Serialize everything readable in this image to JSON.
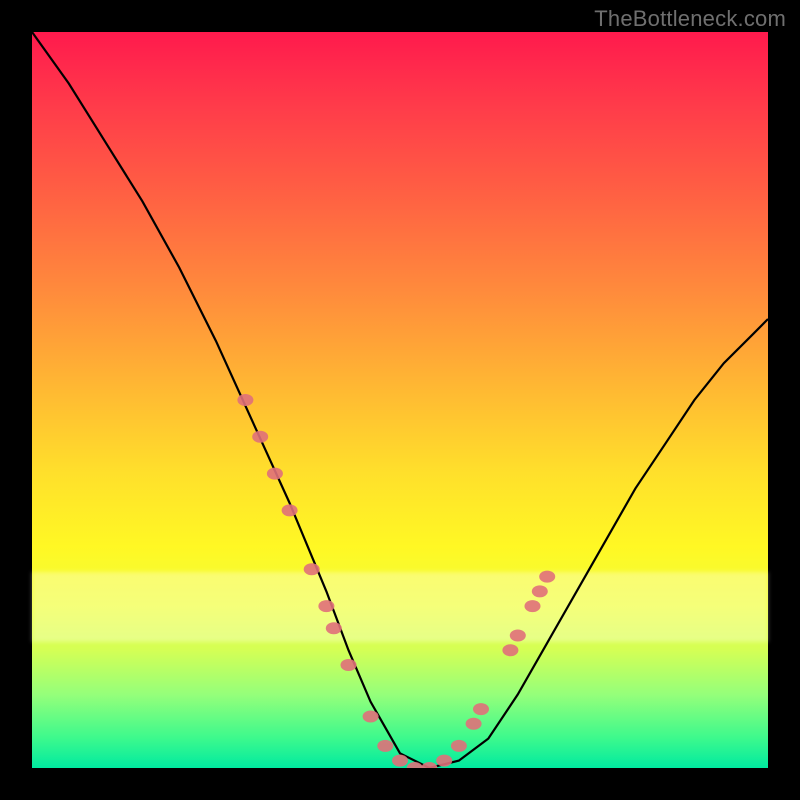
{
  "watermark": "TheBottleneck.com",
  "chart_data": {
    "type": "line",
    "title": "",
    "xlabel": "",
    "ylabel": "",
    "xlim": [
      0,
      100
    ],
    "ylim": [
      0,
      100
    ],
    "grid": false,
    "legend": false,
    "series": [
      {
        "name": "curve",
        "x": [
          0,
          5,
          10,
          15,
          20,
          25,
          30,
          35,
          40,
          43,
          46,
          50,
          54,
          58,
          62,
          66,
          70,
          74,
          78,
          82,
          86,
          90,
          94,
          98,
          100
        ],
        "y": [
          100,
          93,
          85,
          77,
          68,
          58,
          47,
          36,
          24,
          16,
          9,
          2,
          0,
          1,
          4,
          10,
          17,
          24,
          31,
          38,
          44,
          50,
          55,
          59,
          61
        ]
      }
    ],
    "markers": [
      {
        "x": 29,
        "y": 50
      },
      {
        "x": 31,
        "y": 45
      },
      {
        "x": 33,
        "y": 40
      },
      {
        "x": 35,
        "y": 35
      },
      {
        "x": 38,
        "y": 27
      },
      {
        "x": 40,
        "y": 22
      },
      {
        "x": 41,
        "y": 19
      },
      {
        "x": 43,
        "y": 14
      },
      {
        "x": 46,
        "y": 7
      },
      {
        "x": 48,
        "y": 3
      },
      {
        "x": 50,
        "y": 1
      },
      {
        "x": 52,
        "y": 0
      },
      {
        "x": 54,
        "y": 0
      },
      {
        "x": 56,
        "y": 1
      },
      {
        "x": 58,
        "y": 3
      },
      {
        "x": 60,
        "y": 6
      },
      {
        "x": 61,
        "y": 8
      },
      {
        "x": 65,
        "y": 16
      },
      {
        "x": 66,
        "y": 18
      },
      {
        "x": 68,
        "y": 22
      },
      {
        "x": 69,
        "y": 24
      },
      {
        "x": 70,
        "y": 26
      }
    ]
  }
}
